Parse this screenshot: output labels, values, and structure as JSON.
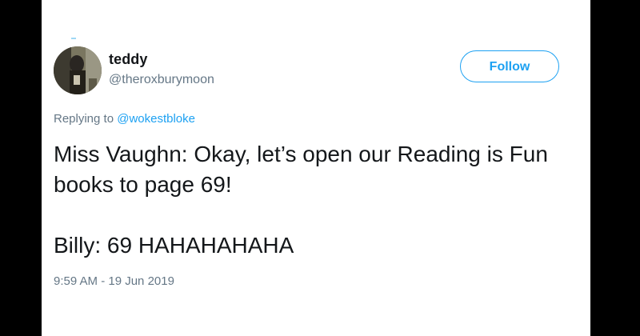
{
  "tweet": {
    "display_name": "teddy",
    "handle": "@theroxburymoon",
    "follow_label": "Follow",
    "replying_prefix": "Replying to",
    "replying_to": "@wokestbloke",
    "text_lines": [
      "Miss Vaughn: Okay, let’s open our Reading is Fun books to page 69!",
      "Billy: 69 HAHAHAHAHA"
    ],
    "timestamp": "9:59 AM - 19 Jun 2019"
  },
  "colors": {
    "accent": "#1da1f2",
    "secondary_text": "#657786",
    "primary_text": "#14171a",
    "letterbox": "#000000",
    "card_background": "#ffffff"
  },
  "icons": {
    "avatar": "profile-photo"
  }
}
